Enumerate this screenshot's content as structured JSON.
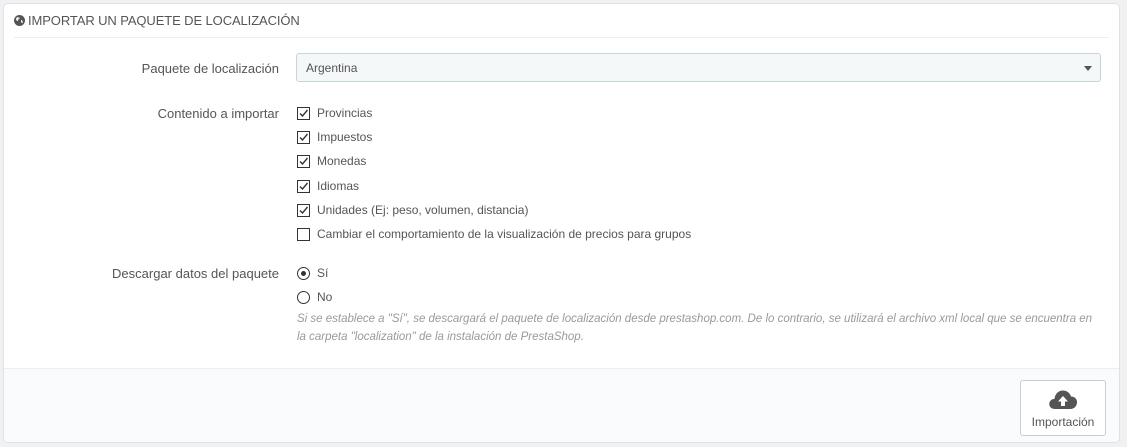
{
  "panel": {
    "title": "Importar un paquete de localización",
    "title_icon": "globe-icon"
  },
  "form": {
    "pack_label": "Paquete de localización",
    "pack_value": "Argentina",
    "content_label": "Contenido a importar",
    "content_items": [
      {
        "label": "Provincias",
        "checked": true
      },
      {
        "label": "Impuestos",
        "checked": true
      },
      {
        "label": "Monedas",
        "checked": true
      },
      {
        "label": "Idiomas",
        "checked": true
      },
      {
        "label": "Unidades (Ej: peso, volumen, distancia)",
        "checked": true
      },
      {
        "label": "Cambiar el comportamiento de la visualización de precios para grupos",
        "checked": false
      }
    ],
    "download_label": "Descargar datos del paquete",
    "download_options": [
      {
        "label": "Sí",
        "selected": true
      },
      {
        "label": "No",
        "selected": false
      }
    ],
    "help_text": "Si se establece a \"Sí\", se descargará el paquete de localización desde prestashop.com. De lo contrario, se utilizará el archivo xml local que se encuentra en la carpeta \"localization\" de la instalación de PrestaShop."
  },
  "footer": {
    "import_label": "Importación",
    "import_icon": "cloud-upload-icon"
  }
}
